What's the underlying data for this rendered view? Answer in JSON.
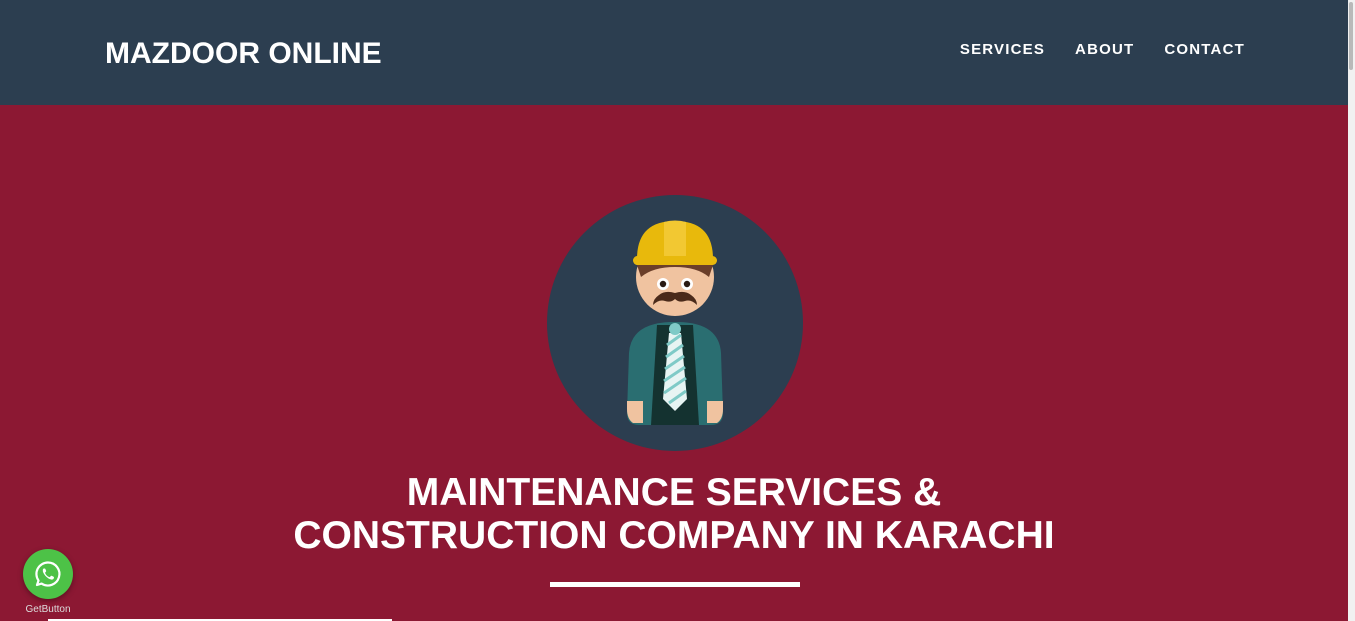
{
  "header": {
    "brand": "MAZDOOR ONLINE",
    "nav": [
      {
        "label": "SERVICES"
      },
      {
        "label": "ABOUT"
      },
      {
        "label": "CONTACT"
      }
    ]
  },
  "hero": {
    "title_line1": "MAINTENANCE SERVICES &",
    "title_line2": "CONSTRUCTION COMPANY IN KARACHI",
    "avatar_icon": "construction-worker-icon"
  },
  "whatsapp": {
    "icon": "whatsapp-icon",
    "caption": "GetButton"
  },
  "colors": {
    "navbar": "#2c3e50",
    "hero": "#8c1833",
    "whatsapp": "#4dc247",
    "helmet": "#e8b90c"
  }
}
